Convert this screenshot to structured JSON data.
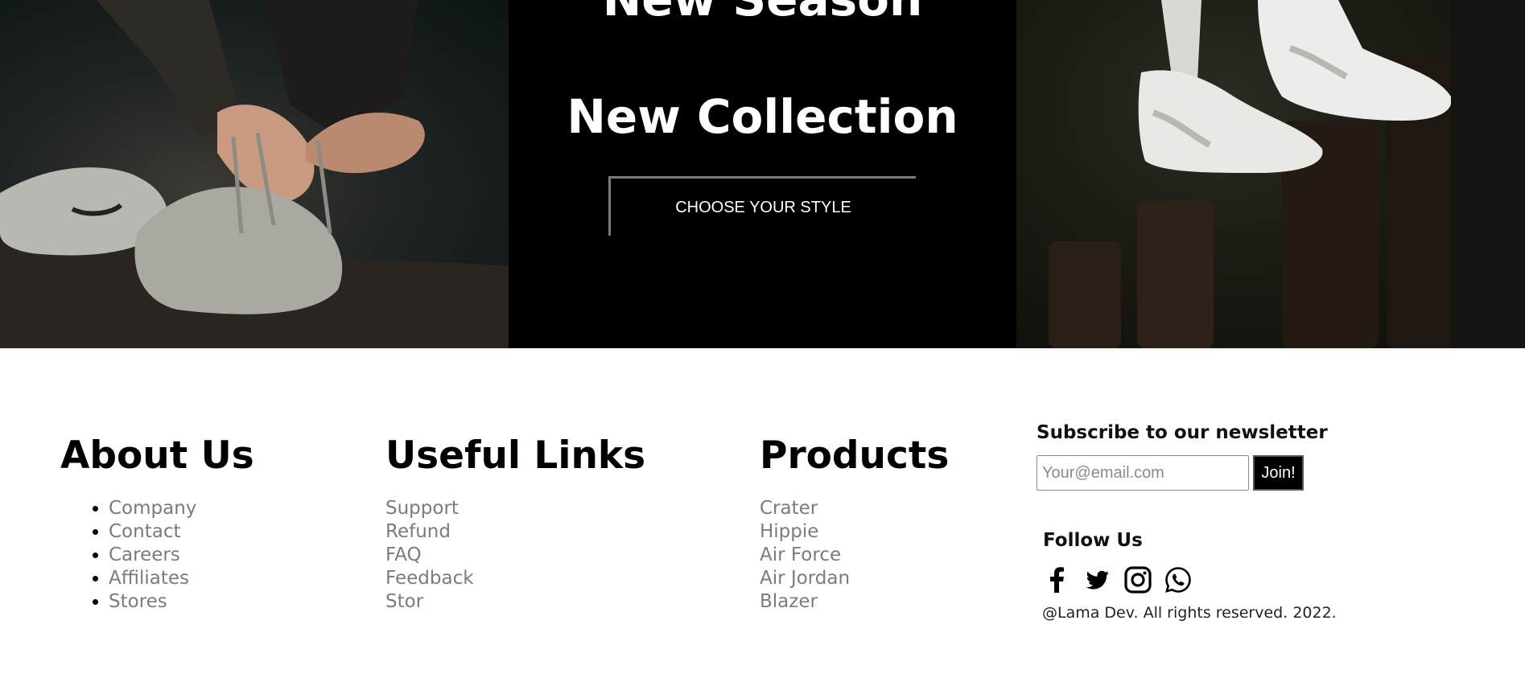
{
  "hero": {
    "title_line1": "New Season",
    "title_line2": "New Collection",
    "cta_label": "CHOOSE YOUR STYLE"
  },
  "footer": {
    "about": {
      "heading": "About Us",
      "items": [
        "Company",
        "Contact",
        "Careers",
        "Affiliates",
        "Stores"
      ]
    },
    "useful_links": {
      "heading": "Useful Links",
      "items": [
        "Support",
        "Refund",
        "FAQ",
        "Feedback",
        "Stor"
      ]
    },
    "products": {
      "heading": "Products",
      "items": [
        "Crater",
        "Hippie",
        "Air Force",
        "Air Jordan",
        "Blazer"
      ]
    },
    "newsletter": {
      "heading": "Subscribe to our newsletter",
      "placeholder": "Your@email.com",
      "button_label": "Join!"
    },
    "follow": {
      "heading": "Follow Us",
      "icons": [
        "facebook-icon",
        "twitter-icon",
        "instagram-icon",
        "whatsapp-icon"
      ]
    },
    "copyright": "@Lama Dev. All rights reserved. 2022."
  }
}
